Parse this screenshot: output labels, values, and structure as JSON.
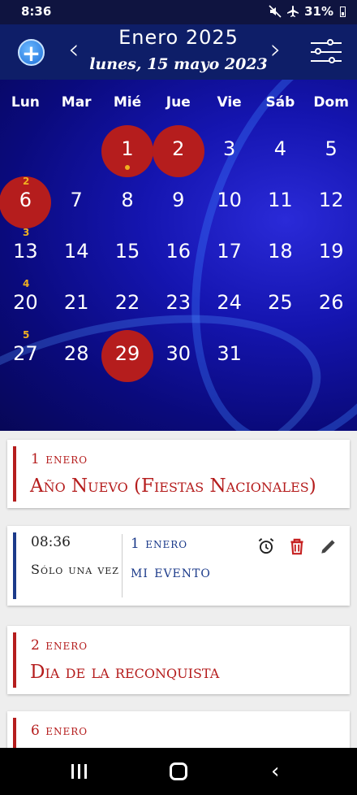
{
  "status": {
    "time": "8:36",
    "battery": "31%"
  },
  "header": {
    "month": "Enero 2025",
    "selected_date": "lunes, 15 mayo 2023",
    "prev": "‹",
    "next": "›",
    "add": "+"
  },
  "calendar": {
    "weekdays": [
      "Lun",
      "Mar",
      "Mié",
      "Jue",
      "Vie",
      "Sáb",
      "Dom"
    ],
    "weeks": [
      {
        "num": "",
        "days": [
          "",
          "",
          "1",
          "2",
          "3",
          "4",
          "5"
        ]
      },
      {
        "num": "2",
        "days": [
          "6",
          "7",
          "8",
          "9",
          "10",
          "11",
          "12"
        ]
      },
      {
        "num": "3",
        "days": [
          "13",
          "14",
          "15",
          "16",
          "17",
          "18",
          "19"
        ]
      },
      {
        "num": "4",
        "days": [
          "20",
          "21",
          "22",
          "23",
          "24",
          "25",
          "26"
        ]
      },
      {
        "num": "5",
        "days": [
          "27",
          "28",
          "29",
          "30",
          "31",
          "",
          ""
        ]
      }
    ],
    "holidays": [
      "1",
      "2",
      "6",
      "29"
    ],
    "event_days": [
      "1"
    ],
    "colors": {
      "holiday": "#b51d1d",
      "week_number": "#f0b020"
    }
  },
  "events": [
    {
      "date": "1 enero",
      "title": "Año Nuevo (Fiestas Nacionales)",
      "type": "holiday"
    },
    {
      "time": "08:36",
      "repeat": "Sólo una vez",
      "date": "1 enero",
      "title": "mi evento",
      "type": "user"
    },
    {
      "date": "2 enero",
      "title": "Dia de la reconquista",
      "type": "holiday"
    },
    {
      "date": "6 enero",
      "title": "",
      "type": "holiday"
    }
  ],
  "colors": {
    "header": "#0e1e68",
    "accent_red": "#b51d1d",
    "accent_blue": "#1b3a8a"
  }
}
